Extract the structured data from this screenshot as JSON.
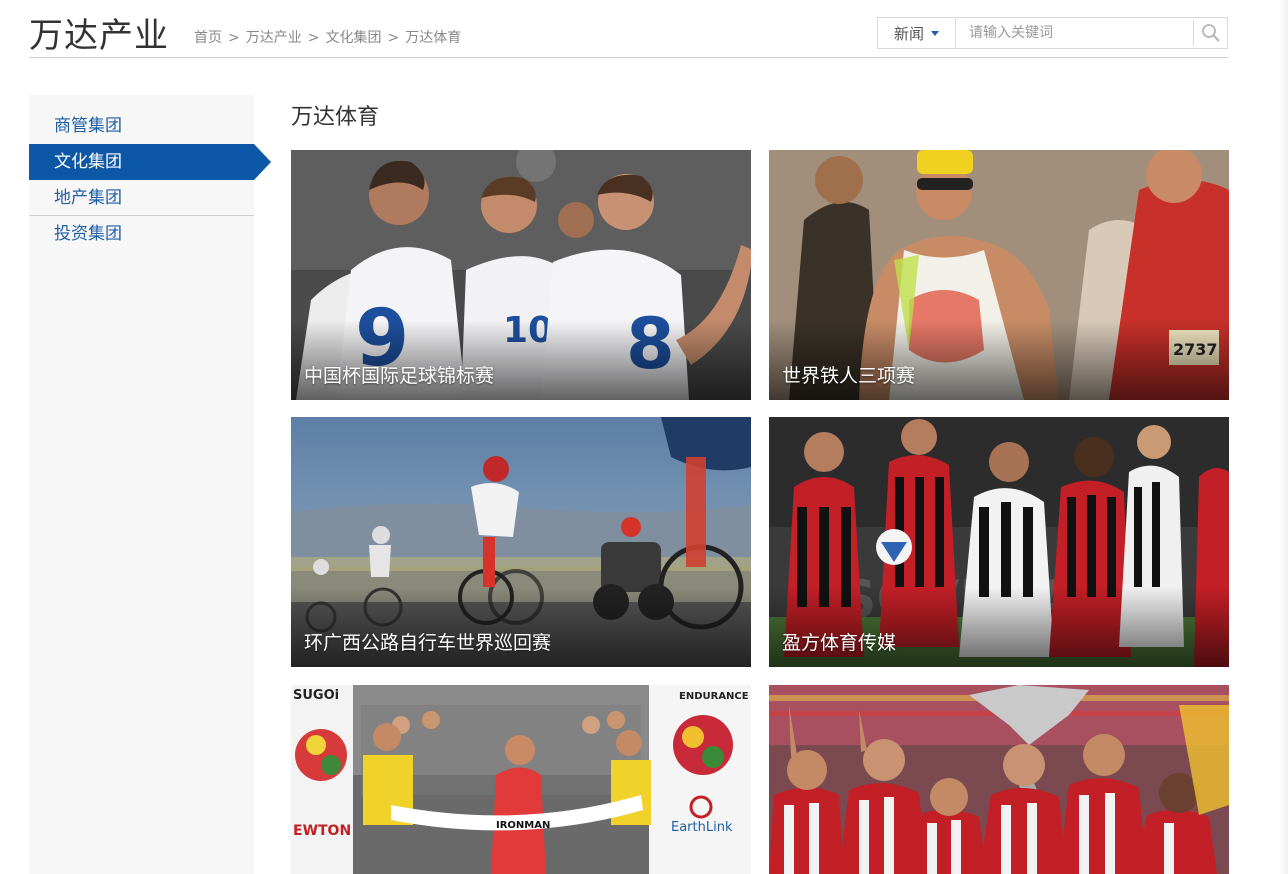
{
  "header": {
    "site_title": "万达产业",
    "breadcrumb": [
      "首页",
      "万达产业",
      "文化集团",
      "万达体育"
    ],
    "breadcrumb_separator": ">"
  },
  "search": {
    "category": "新闻",
    "placeholder": "请输入关键词",
    "icon": "search-icon"
  },
  "sidebar": {
    "items": [
      {
        "label": "商管集团",
        "active": false
      },
      {
        "label": "文化集团",
        "active": true
      },
      {
        "label": "地产集团",
        "active": false
      },
      {
        "label": "投资集团",
        "active": false
      }
    ]
  },
  "main": {
    "section_title": "万达体育",
    "cards": [
      {
        "caption": "中国杯国际足球锦标赛"
      },
      {
        "caption": "世界铁人三项赛"
      },
      {
        "caption": "环广西公路自行车世界巡回赛"
      },
      {
        "caption": "盈方体育传媒"
      },
      {
        "caption": ""
      },
      {
        "caption": ""
      }
    ]
  },
  "colors": {
    "accent": "#0d58a6",
    "link": "#1f5fa6",
    "sidebar_bg": "#f7f7f7"
  }
}
